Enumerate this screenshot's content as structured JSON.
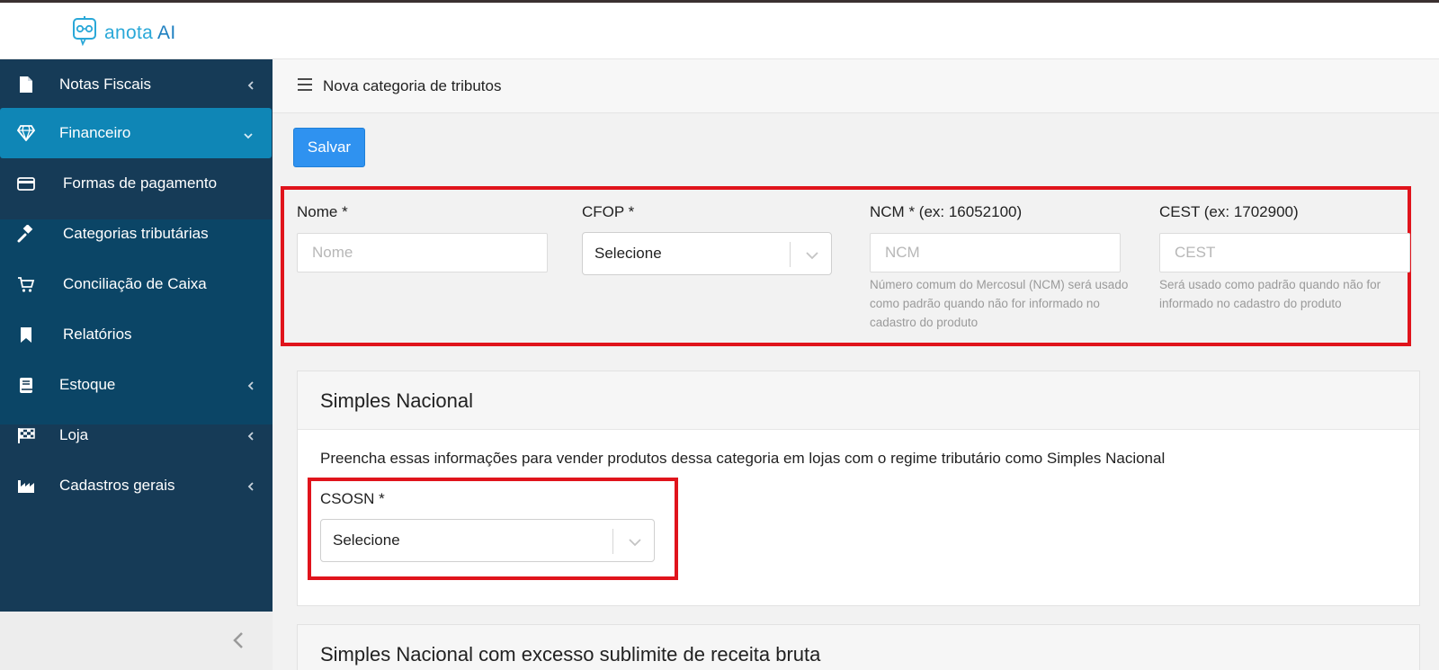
{
  "app": {
    "logo_text_1": "anota",
    "logo_text_2": "AI"
  },
  "sidebar": {
    "items": [
      {
        "label": "Notas Fiscais",
        "icon": "file-icon"
      },
      {
        "label": "Financeiro",
        "icon": "diamond-icon",
        "active": true
      },
      {
        "label": "Formas de pagamento",
        "icon": "credit-card-icon"
      },
      {
        "label": "Categorias tributárias",
        "icon": "gavel-icon"
      },
      {
        "label": "Conciliação de Caixa",
        "icon": "cart-icon"
      },
      {
        "label": "Relatórios",
        "icon": "bookmark-icon"
      },
      {
        "label": "Estoque",
        "icon": "book-icon"
      },
      {
        "label": "Loja",
        "icon": "flag-checkered-icon"
      },
      {
        "label": "Cadastros gerais",
        "icon": "industry-icon"
      }
    ]
  },
  "header": {
    "title": "Nova categoria de tributos"
  },
  "toolbar": {
    "save_label": "Salvar"
  },
  "form": {
    "nome_label": "Nome *",
    "nome_placeholder": "Nome",
    "cfop_label": "CFOP *",
    "cfop_value": "Selecione",
    "ncm_label": "NCM * (ex: 16052100)",
    "ncm_placeholder": "NCM",
    "ncm_help": "Número comum do Mercosul (NCM) será usado como padrão quando não for informado no cadastro do produto",
    "cest_label": "CEST (ex: 1702900)",
    "cest_placeholder": "CEST",
    "cest_help": "Será usado como padrão quando não for informado no cadastro do produto"
  },
  "simples": {
    "title": "Simples Nacional",
    "description": "Preencha essas informações para vender produtos dessa categoria em lojas com o regime tributário como Simples Nacional",
    "csosn_label": "CSOSN *",
    "csosn_value": "Selecione"
  },
  "simples_excesso": {
    "title": "Simples Nacional com excesso sublimite de receita bruta"
  },
  "colors": {
    "sidebar_bg": "#163b57",
    "active_item": "#0f86b6",
    "primary_button": "#2f92f0",
    "highlight_border": "#e0141c"
  }
}
